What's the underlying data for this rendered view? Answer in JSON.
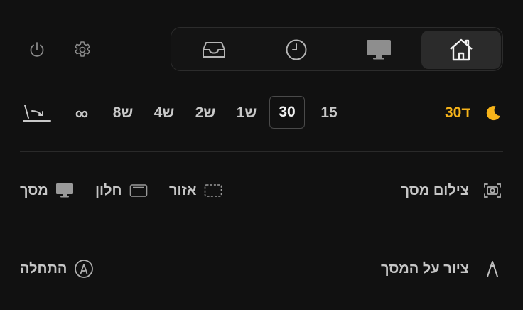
{
  "tabs": [
    {
      "icon": "inbox-tray-icon",
      "active": false
    },
    {
      "icon": "clock-icon",
      "active": false
    },
    {
      "icon": "monitor-icon",
      "active": false
    },
    {
      "icon": "home-icon",
      "active": true
    }
  ],
  "top_left": [
    {
      "icon": "power-icon"
    },
    {
      "icon": "gear-icon"
    }
  ],
  "durations": {
    "infinity": "∞",
    "items": [
      "8ש",
      "4ש",
      "2ש",
      "1ש",
      "30",
      "15"
    ],
    "selected": "30",
    "timer_label": "30ד",
    "timer_color": "#f7b41a"
  },
  "screenshot": {
    "title": "צילום מסך",
    "buttons": {
      "screen": "מסך",
      "window": "חלון",
      "area": "אזור"
    }
  },
  "draw": {
    "title": "ציור על המסך",
    "start": "התחלה"
  }
}
